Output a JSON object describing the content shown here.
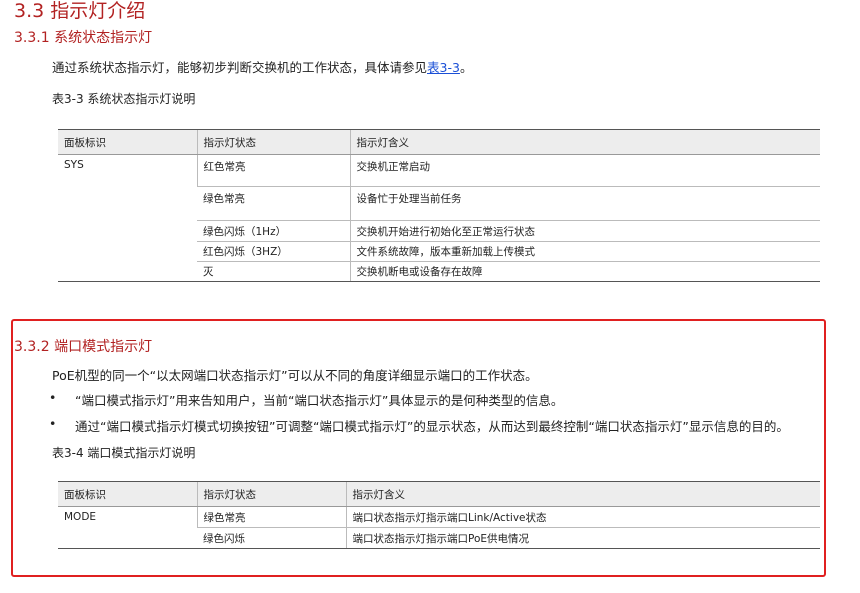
{
  "section": {
    "title": "3.3 指示灯介绍"
  },
  "sub1": {
    "title": "3.3.1 系统状态指示灯",
    "intro_prefix": "通过系统状态指示灯，能够初步判断交换机的工作状态，具体请参见",
    "intro_link": "表3-3",
    "intro_suffix": "。",
    "table_caption": "表3-3 系统状态指示灯说明",
    "headers": [
      "面板标识",
      "指示灯状态",
      "指示灯含义"
    ],
    "label": "SYS",
    "rows": [
      {
        "state": "红色常亮",
        "meaning": "交换机正常启动"
      },
      {
        "state": "绿色常亮",
        "meaning": "设备忙于处理当前任务"
      },
      {
        "state": "绿色闪烁（1Hz）",
        "meaning": "交换机开始进行初始化至正常运行状态"
      },
      {
        "state": "红色闪烁（3HZ）",
        "meaning": "文件系统故障，版本重新加载上传模式"
      },
      {
        "state": "灭",
        "meaning": "交换机断电或设备存在故障"
      }
    ]
  },
  "sub2": {
    "title": "3.3.2 端口模式指示灯",
    "intro": "PoE机型的同一个“以太网端口状态指示灯”可以从不同的角度详细显示端口的工作状态。",
    "bullets": [
      "“端口模式指示灯”用来告知用户，当前“端口状态指示灯”具体显示的是何种类型的信息。",
      "通过“端口模式指示灯模式切换按钮”可调整“端口模式指示灯”的显示状态，从而达到最终控制“端口状态指示灯”显示信息的目的。"
    ],
    "bullet_glyph": "•",
    "table_caption": "表3-4 端口模式指示灯说明",
    "headers": [
      "面板标识",
      "指示灯状态",
      "指示灯含义"
    ],
    "label": "MODE",
    "rows": [
      {
        "state": "绿色常亮",
        "meaning": "端口状态指示灯指示端口Link/Active状态"
      },
      {
        "state": "绿色闪烁",
        "meaning": "端口状态指示灯指示端口PoE供电情况"
      }
    ]
  }
}
